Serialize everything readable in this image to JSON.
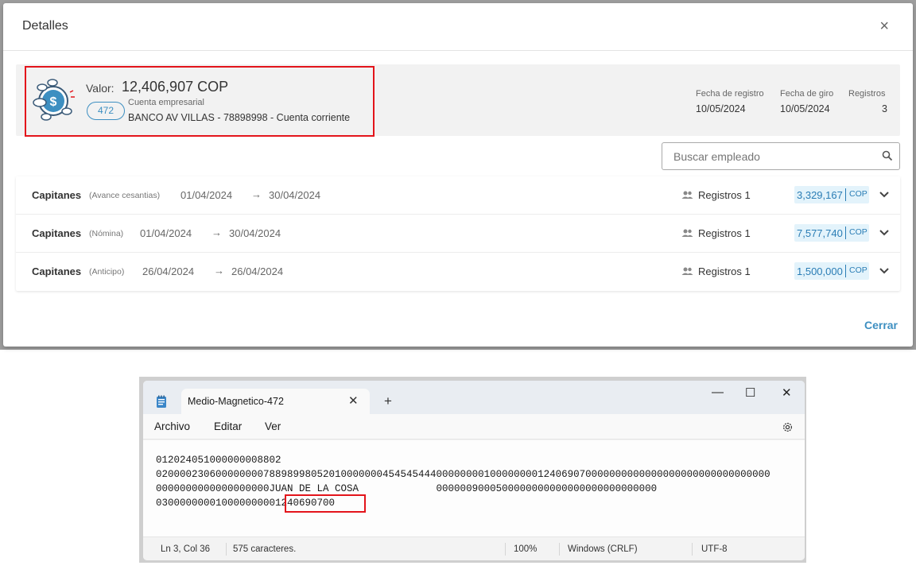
{
  "modal": {
    "title": "Detalles",
    "close_glyph": "×",
    "summary": {
      "valor_label": "Valor:",
      "valor_value": "12,406,907 COP",
      "badge": "472",
      "account_type": "Cuenta empresarial",
      "account_desc": "BANCO AV VILLAS - 78898998 - Cuenta corriente",
      "icon": "money-coin-icon",
      "meta": [
        {
          "label": "Fecha de registro",
          "value": "10/05/2024"
        },
        {
          "label": "Fecha de giro",
          "value": "10/05/2024"
        },
        {
          "label": "Registros",
          "value": "3"
        }
      ]
    },
    "search": {
      "placeholder": "Buscar empleado",
      "value": "",
      "icon": "search-icon"
    },
    "rows": [
      {
        "name": "Capitanes",
        "type": "(Avance cesantias)",
        "from": "01/04/2024",
        "to": "30/04/2024",
        "registros": "Registros 1",
        "amount": "3,329,167",
        "currency": "COP"
      },
      {
        "name": "Capitanes",
        "type": "(Nómina)",
        "from": "01/04/2024",
        "to": "30/04/2024",
        "registros": "Registros 1",
        "amount": "7,577,740",
        "currency": "COP"
      },
      {
        "name": "Capitanes",
        "type": "(Anticipo)",
        "from": "26/04/2024",
        "to": "26/04/2024",
        "registros": "Registros 1",
        "amount": "1,500,000",
        "currency": "COP"
      }
    ],
    "arrow_glyph": "→",
    "close_button": "Cerrar",
    "accent_color": "#3d8fc1",
    "highlight_color": "#e3141b"
  },
  "notepad": {
    "tab_title": "Medio-Magnetico-472",
    "tab_close": "✕",
    "new_tab": "+",
    "window_buttons": {
      "minimize": "—",
      "maximize": "☐",
      "close": "✕"
    },
    "menu": [
      "Archivo",
      "Editar",
      "Ver"
    ],
    "lines": [
      "012024051000000008802",
      "0200002306000000007889899805201000000045454544400000000100000000124069070000000000000000000000000000000",
      "0000000000000000000JUAN DE LA COSA             0000009000500000000000000000000000000",
      "03000000001000000000124069070 0"
    ],
    "line4_visible": "0300000000100000000",
    "line4_highlight": "01240690700",
    "status": {
      "position": "Ln 3, Col 36",
      "chars": "575 caracteres.",
      "zoom": "100%",
      "eol": "Windows (CRLF)",
      "encoding": "UTF-8"
    }
  }
}
